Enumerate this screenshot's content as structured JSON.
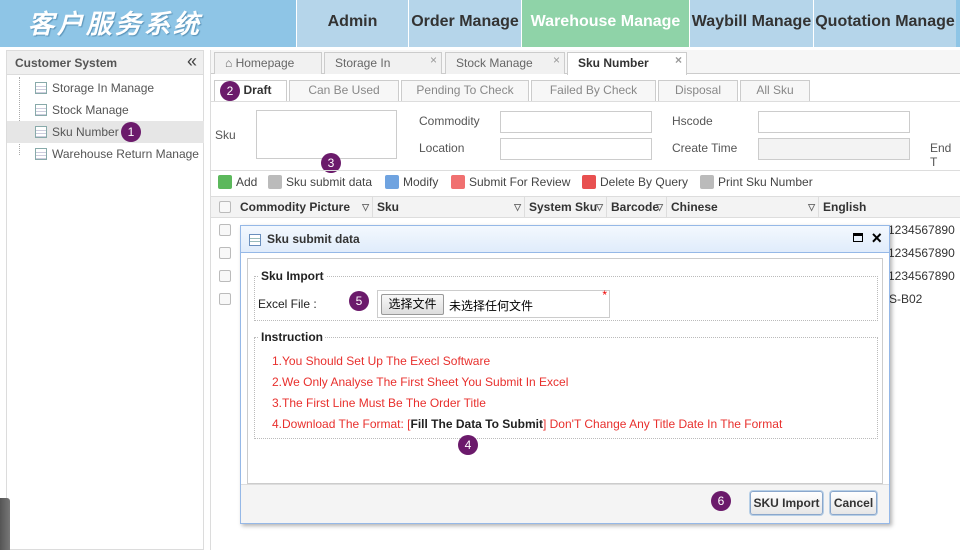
{
  "header": {
    "logo": "客户服务系统",
    "nav": [
      "Admin",
      "Order Manage",
      "Warehouse Manage",
      "Waybill Manage",
      "Quotation Manage"
    ]
  },
  "sidebar": {
    "title": "Customer System",
    "items": [
      "Storage In Manage",
      "Stock Manage",
      "Sku Number",
      "Warehouse Return Manage"
    ]
  },
  "tabs": [
    "Homepage",
    "Storage In",
    "Stock Manage",
    "Sku Number"
  ],
  "subtabs": [
    "Draft",
    "Can Be Used",
    "Pending To Check",
    "Failed By Check",
    "Disposal",
    "All Sku"
  ],
  "filters": {
    "sku": "Sku",
    "commodity": "Commodity",
    "hscode": "Hscode",
    "location": "Location",
    "create_time": "Create Time",
    "end_time": "End T"
  },
  "toolbar": [
    "Add",
    "Sku submit data",
    "Modify",
    "Submit For Review",
    "Delete By Query",
    "Print Sku Number"
  ],
  "grid": {
    "columns": [
      "Commodity Picture",
      "Sku",
      "System Sku",
      "Barcode",
      "Chinese",
      "English"
    ],
    "english_values": [
      "1234567890",
      "1234567890",
      "1234567890",
      "S-B02"
    ]
  },
  "dialog": {
    "title": "Sku submit data",
    "import_legend": "Sku Import",
    "excel_label": "Excel File :",
    "file_button": "选择文件",
    "file_status": "未选择任何文件",
    "required_mark": "*",
    "instruction_legend": "Instruction",
    "instructions": {
      "line1": "1.You Should Set Up The Execl Software",
      "line2": "2.We Only Analyse The First Sheet You Submit In Excel",
      "line3": "3.The First Line Must Be The Order Title",
      "line4_prefix": "4.Download The Format: [",
      "line4_link": "Fill The Data To Submit",
      "line4_suffix": "] Don'T Change Any Title Date In The Format"
    },
    "import_button": "SKU Import",
    "cancel_button": "Cancel"
  },
  "markers": [
    "1",
    "2",
    "3",
    "4",
    "5",
    "6"
  ],
  "colors": {
    "topbar": "#8ec5e6",
    "active_nav": "#8fd3a8",
    "marker": "#6b1a6b",
    "instruction_text": "#e8302d"
  }
}
